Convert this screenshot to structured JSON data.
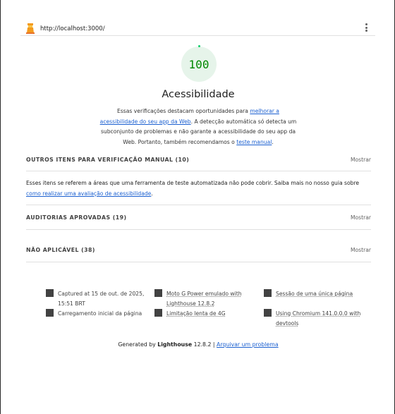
{
  "header": {
    "url": "http://localhost:3000/"
  },
  "category": {
    "score": "100",
    "title": "Acessibilidade",
    "desc_1": "Essas verificações destacam oportunidades para ",
    "desc_link_1": "melhorar a acessibilidade do seu app da Web",
    "desc_2": ". A detecção automática só detecta um subconjunto de problemas e não garante a acessibilidade do seu app da Web. Portanto, também recomendamos o ",
    "desc_link_2": "teste manual",
    "desc_3": "."
  },
  "sections": {
    "manual": {
      "label": "OUTROS ITENS PARA VERIFICAÇÃO MANUAL (10)",
      "toggle": "Mostrar",
      "desc_1": "Esses itens se referem a áreas que uma ferramenta de teste automatizada não pode cobrir. Saiba mais no nosso guia sobre ",
      "desc_link": "como realizar uma avaliação de acessibilidade",
      "desc_2": "."
    },
    "passed": {
      "label": "AUDITORIAS APROVADAS (19)",
      "toggle": "Mostrar"
    },
    "not_applicable": {
      "label": "NÃO APLICÁVEL (38)",
      "toggle": "Mostrar"
    }
  },
  "environment": {
    "captured": "Captured at 15 de out. de 2025, 15:51 BRT",
    "initial_load": "Carregamento inicial da página",
    "device": "Moto G Power emulado with Lighthouse 12.8.2",
    "throttling": "Limitação lenta de 4G",
    "session": "Sessão de uma única página",
    "browser": "Using Chromium 141.0.0.0 with devtools"
  },
  "footer": {
    "generated_by": "Generated by ",
    "product": "Lighthouse",
    "version": " 12.8.2 | ",
    "issue_link": "Arquivar um problema"
  }
}
